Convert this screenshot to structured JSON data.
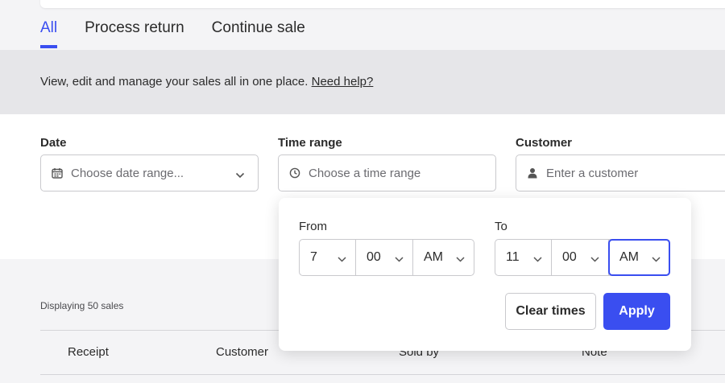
{
  "tabs": [
    {
      "label": "All",
      "active": true
    },
    {
      "label": "Process return",
      "active": false
    },
    {
      "label": "Continue sale",
      "active": false
    }
  ],
  "banner": {
    "text": "View, edit and manage your sales all in one place.",
    "help_link": "Need help?"
  },
  "filters": {
    "date": {
      "label": "Date",
      "placeholder": "Choose date range...",
      "icon": "calendar-icon"
    },
    "time_range": {
      "label": "Time range",
      "placeholder": "Choose a time range",
      "icon": "clock-icon"
    },
    "customer": {
      "label": "Customer",
      "placeholder": "Enter a customer",
      "icon": "user-icon"
    }
  },
  "time_popover": {
    "from_label": "From",
    "to_label": "To",
    "from": {
      "hour": "7",
      "minute": "00",
      "period": "AM"
    },
    "to": {
      "hour": "11",
      "minute": "00",
      "period": "AM"
    },
    "clear_label": "Clear times",
    "apply_label": "Apply"
  },
  "list": {
    "count_text": "Displaying 50 sales",
    "columns": [
      "Receipt",
      "Customer",
      "Sold by",
      "Note"
    ]
  },
  "colors": {
    "accent": "#3a4ef0",
    "banner_bg": "#e6e6e9",
    "page_bg": "#f4f4f6"
  }
}
